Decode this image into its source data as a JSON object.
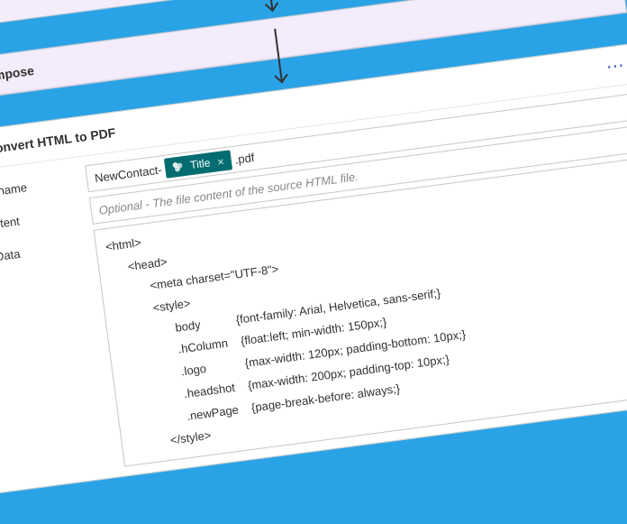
{
  "top_card": {
    "menu": "⋯"
  },
  "compose": {
    "title": "Compose",
    "menu": "⋯"
  },
  "convert": {
    "title": "Convert HTML to PDF",
    "menu": "⋯",
    "rows": {
      "pdf_filename": {
        "label": "PDF Filename",
        "prefix": "NewContact-",
        "token_label": "Title",
        "suffix": ".pdf"
      },
      "file_content": {
        "label": "File Content",
        "placeholder": "Optional - The file content of the source HTML file."
      },
      "html_data": {
        "label": "HTML Data",
        "code": "<html>\n      <head>\n            <meta charset=\"UTF-8\">\n            <style>\n                  body           {font-family: Arial, Helvetica, sans-serif;}\n                  .hColumn    {float:left; min-width: 150px;}\n                  .logo            {max-width: 120px; padding-bottom: 10px;}\n                  .headshot    {max-width: 200px; padding-top: 10px;}\n                  .newPage    {page-break-before: always;}\n            </style>"
      }
    }
  }
}
